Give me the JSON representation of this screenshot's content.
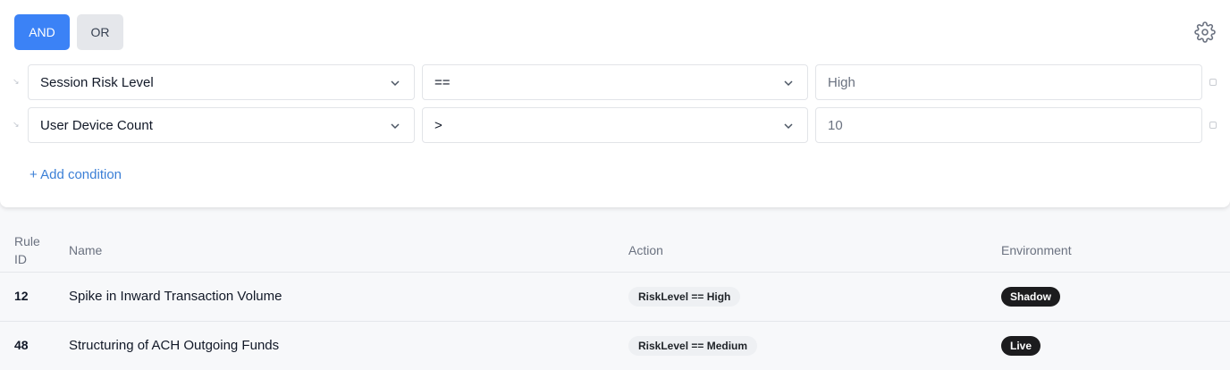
{
  "logic": {
    "and_label": "AND",
    "or_label": "OR",
    "selected": "AND"
  },
  "conditions": [
    {
      "field": "Session Risk Level",
      "operator": "==",
      "value": "High"
    },
    {
      "field": "User Device Count",
      "operator": ">",
      "value": "10"
    }
  ],
  "add_condition_label": "+ Add condition",
  "table": {
    "headers": {
      "rule_id_line1": "Rule",
      "rule_id_line2": "ID",
      "name": "Name",
      "action": "Action",
      "environment": "Environment"
    },
    "rows": [
      {
        "id": "12",
        "name": "Spike in Inward Transaction Volume",
        "action": "RiskLevel == High",
        "environment": "Shadow"
      },
      {
        "id": "48",
        "name": "Structuring of ACH Outgoing Funds",
        "action": "RiskLevel == Medium",
        "environment": "Live"
      }
    ]
  },
  "colors": {
    "accent": "#3b82f6",
    "link": "#3b7fd6",
    "env_badge": "#1c1c1e",
    "action_pill": "#eef0f3"
  }
}
